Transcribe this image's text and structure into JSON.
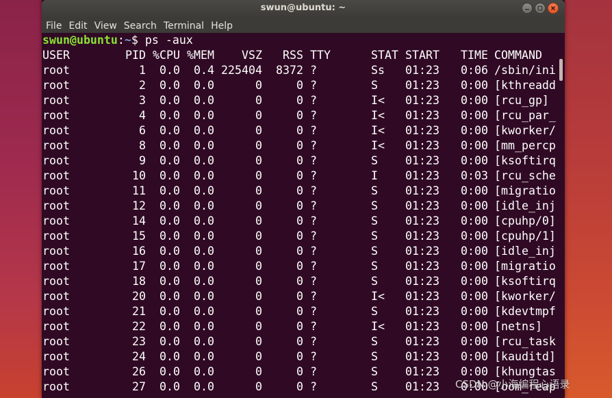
{
  "window": {
    "title": "swun@ubuntu: ~"
  },
  "menu": [
    "File",
    "Edit",
    "View",
    "Search",
    "Terminal",
    "Help"
  ],
  "prompt": {
    "user_host": "swun@ubuntu",
    "colon": ":",
    "path": "~",
    "dollar": "$ ",
    "command": "ps -aux"
  },
  "table": {
    "headers": {
      "user": "USER",
      "pid": "PID",
      "cpu": "%CPU",
      "mem": "%MEM",
      "vsz": "VSZ",
      "rss": "RSS",
      "tty": "TTY",
      "stat": "STAT",
      "start": "START",
      "time": "TIME",
      "command": "COMMAND"
    },
    "rows": [
      {
        "user": "root",
        "pid": "1",
        "cpu": "0.0",
        "mem": "0.4",
        "vsz": "225404",
        "rss": "8372",
        "tty": "?",
        "stat": "Ss",
        "start": "01:23",
        "time": "0:06",
        "command": "/sbin/ini"
      },
      {
        "user": "root",
        "pid": "2",
        "cpu": "0.0",
        "mem": "0.0",
        "vsz": "0",
        "rss": "0",
        "tty": "?",
        "stat": "S",
        "start": "01:23",
        "time": "0:00",
        "command": "[kthreadd"
      },
      {
        "user": "root",
        "pid": "3",
        "cpu": "0.0",
        "mem": "0.0",
        "vsz": "0",
        "rss": "0",
        "tty": "?",
        "stat": "I<",
        "start": "01:23",
        "time": "0:00",
        "command": "[rcu_gp]"
      },
      {
        "user": "root",
        "pid": "4",
        "cpu": "0.0",
        "mem": "0.0",
        "vsz": "0",
        "rss": "0",
        "tty": "?",
        "stat": "I<",
        "start": "01:23",
        "time": "0:00",
        "command": "[rcu_par_"
      },
      {
        "user": "root",
        "pid": "6",
        "cpu": "0.0",
        "mem": "0.0",
        "vsz": "0",
        "rss": "0",
        "tty": "?",
        "stat": "I<",
        "start": "01:23",
        "time": "0:00",
        "command": "[kworker/"
      },
      {
        "user": "root",
        "pid": "8",
        "cpu": "0.0",
        "mem": "0.0",
        "vsz": "0",
        "rss": "0",
        "tty": "?",
        "stat": "I<",
        "start": "01:23",
        "time": "0:00",
        "command": "[mm_percp"
      },
      {
        "user": "root",
        "pid": "9",
        "cpu": "0.0",
        "mem": "0.0",
        "vsz": "0",
        "rss": "0",
        "tty": "?",
        "stat": "S",
        "start": "01:23",
        "time": "0:00",
        "command": "[ksoftirq"
      },
      {
        "user": "root",
        "pid": "10",
        "cpu": "0.0",
        "mem": "0.0",
        "vsz": "0",
        "rss": "0",
        "tty": "?",
        "stat": "I",
        "start": "01:23",
        "time": "0:03",
        "command": "[rcu_sche"
      },
      {
        "user": "root",
        "pid": "11",
        "cpu": "0.0",
        "mem": "0.0",
        "vsz": "0",
        "rss": "0",
        "tty": "?",
        "stat": "S",
        "start": "01:23",
        "time": "0:00",
        "command": "[migratio"
      },
      {
        "user": "root",
        "pid": "12",
        "cpu": "0.0",
        "mem": "0.0",
        "vsz": "0",
        "rss": "0",
        "tty": "?",
        "stat": "S",
        "start": "01:23",
        "time": "0:00",
        "command": "[idle_inj"
      },
      {
        "user": "root",
        "pid": "14",
        "cpu": "0.0",
        "mem": "0.0",
        "vsz": "0",
        "rss": "0",
        "tty": "?",
        "stat": "S",
        "start": "01:23",
        "time": "0:00",
        "command": "[cpuhp/0]"
      },
      {
        "user": "root",
        "pid": "15",
        "cpu": "0.0",
        "mem": "0.0",
        "vsz": "0",
        "rss": "0",
        "tty": "?",
        "stat": "S",
        "start": "01:23",
        "time": "0:00",
        "command": "[cpuhp/1]"
      },
      {
        "user": "root",
        "pid": "16",
        "cpu": "0.0",
        "mem": "0.0",
        "vsz": "0",
        "rss": "0",
        "tty": "?",
        "stat": "S",
        "start": "01:23",
        "time": "0:00",
        "command": "[idle_inj"
      },
      {
        "user": "root",
        "pid": "17",
        "cpu": "0.0",
        "mem": "0.0",
        "vsz": "0",
        "rss": "0",
        "tty": "?",
        "stat": "S",
        "start": "01:23",
        "time": "0:00",
        "command": "[migratio"
      },
      {
        "user": "root",
        "pid": "18",
        "cpu": "0.0",
        "mem": "0.0",
        "vsz": "0",
        "rss": "0",
        "tty": "?",
        "stat": "S",
        "start": "01:23",
        "time": "0:00",
        "command": "[ksoftirq"
      },
      {
        "user": "root",
        "pid": "20",
        "cpu": "0.0",
        "mem": "0.0",
        "vsz": "0",
        "rss": "0",
        "tty": "?",
        "stat": "I<",
        "start": "01:23",
        "time": "0:00",
        "command": "[kworker/"
      },
      {
        "user": "root",
        "pid": "21",
        "cpu": "0.0",
        "mem": "0.0",
        "vsz": "0",
        "rss": "0",
        "tty": "?",
        "stat": "S",
        "start": "01:23",
        "time": "0:00",
        "command": "[kdevtmpf"
      },
      {
        "user": "root",
        "pid": "22",
        "cpu": "0.0",
        "mem": "0.0",
        "vsz": "0",
        "rss": "0",
        "tty": "?",
        "stat": "I<",
        "start": "01:23",
        "time": "0:00",
        "command": "[netns]"
      },
      {
        "user": "root",
        "pid": "23",
        "cpu": "0.0",
        "mem": "0.0",
        "vsz": "0",
        "rss": "0",
        "tty": "?",
        "stat": "S",
        "start": "01:23",
        "time": "0:00",
        "command": "[rcu_task"
      },
      {
        "user": "root",
        "pid": "24",
        "cpu": "0.0",
        "mem": "0.0",
        "vsz": "0",
        "rss": "0",
        "tty": "?",
        "stat": "S",
        "start": "01:23",
        "time": "0:00",
        "command": "[kauditd]"
      },
      {
        "user": "root",
        "pid": "26",
        "cpu": "0.0",
        "mem": "0.0",
        "vsz": "0",
        "rss": "0",
        "tty": "?",
        "stat": "S",
        "start": "01:23",
        "time": "0:00",
        "command": "[khungtas"
      },
      {
        "user": "root",
        "pid": "27",
        "cpu": "0.0",
        "mem": "0.0",
        "vsz": "0",
        "rss": "0",
        "tty": "?",
        "stat": "S",
        "start": "01:23",
        "time": "0:00",
        "command": "[oom_reap"
      }
    ]
  },
  "watermark": "CSDN @小海编程心语录",
  "colors": {
    "terminal_bg": "#300a24",
    "prompt_user": "#8ae234",
    "prompt_path": "#729fcf",
    "titlebar": "#3c3b37",
    "close_button": "#e95420"
  },
  "icons": {
    "minimize": "minimize-icon",
    "maximize": "maximize-icon",
    "close": "close-icon"
  }
}
